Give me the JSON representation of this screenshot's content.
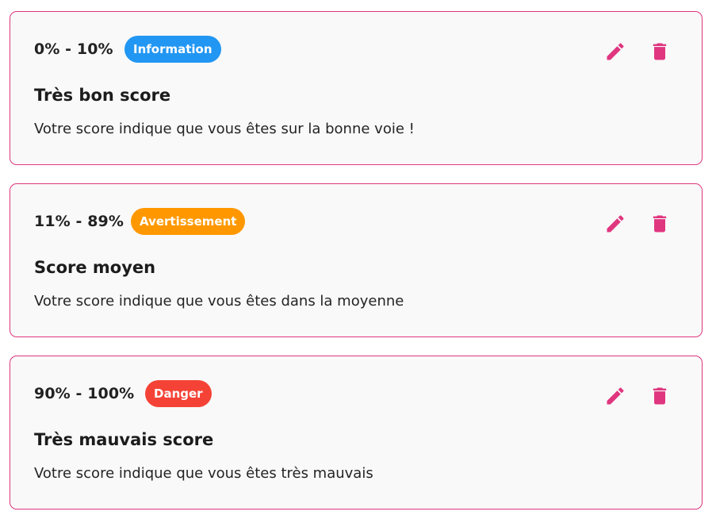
{
  "accent_color": "#e0367f",
  "rules": [
    {
      "range": "0% - 10%",
      "badge": {
        "label": "Information",
        "color": "#2196f3"
      },
      "title": "Très bon score",
      "description": "Votre score indique que vous êtes sur la bonne voie !",
      "edit_icon": "pencil-icon",
      "delete_icon": "trash-icon"
    },
    {
      "range": "11% - 89%",
      "badge": {
        "label": "Avertissement",
        "color": "#ff9800"
      },
      "title": "Score moyen",
      "description": "Votre score indique que vous êtes dans la moyenne",
      "edit_icon": "pencil-icon",
      "delete_icon": "trash-icon"
    },
    {
      "range": "90% - 100%",
      "badge": {
        "label": "Danger",
        "color": "#f44336"
      },
      "title": "Très mauvais score",
      "description": "Votre score indique que vous êtes très mauvais",
      "edit_icon": "pencil-icon",
      "delete_icon": "trash-icon"
    }
  ]
}
